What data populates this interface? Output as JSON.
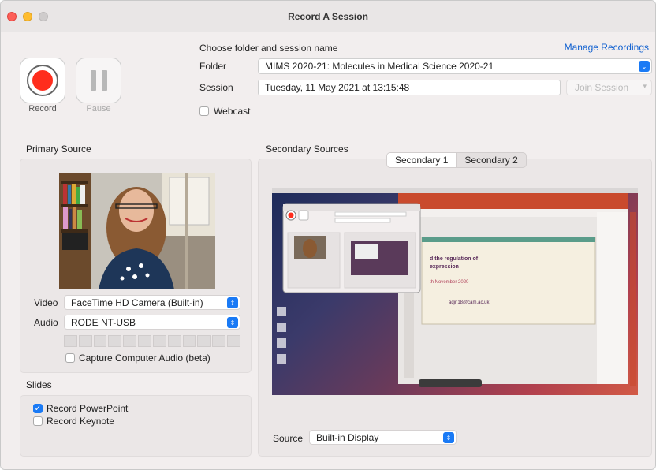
{
  "window": {
    "title": "Record A Session"
  },
  "controls": {
    "record_label": "Record",
    "pause_label": "Pause"
  },
  "header": {
    "choose_label": "Choose folder and session name",
    "manage_link": "Manage Recordings"
  },
  "folder": {
    "label": "Folder",
    "value": "MIMS 2020-21: Molecules in Medical Science 2020-21"
  },
  "session": {
    "label": "Session",
    "value": "Tuesday, 11 May 2021 at 13:15:48",
    "join_label": "Join Session"
  },
  "webcast": {
    "label": "Webcast",
    "checked": false
  },
  "primary": {
    "title": "Primary Source",
    "video_label": "Video",
    "video_value": "FaceTime HD Camera (Built-in)",
    "audio_label": "Audio",
    "audio_value": "RODE NT-USB",
    "meter_segments": 12,
    "capture_audio_label": "Capture Computer Audio (beta)",
    "capture_audio_checked": false
  },
  "slides": {
    "title": "Slides",
    "powerpoint_label": "Record PowerPoint",
    "powerpoint_checked": true,
    "keynote_label": "Record Keynote",
    "keynote_checked": false
  },
  "secondary": {
    "title": "Secondary Sources",
    "tabs": [
      "Secondary 1",
      "Secondary 2"
    ],
    "active_tab": "Secondary 1",
    "source_label": "Source",
    "source_value": "Built-in Display",
    "preview_texts": {
      "slide_title_1": "d the regulation of",
      "slide_title_2": "expression",
      "slide_date": "th November 2020",
      "slide_email": "adjn18@cam.ac.uk"
    }
  },
  "colors": {
    "accent": "#1a7af5",
    "record": "#ff2d1d",
    "link": "#1060d0"
  }
}
